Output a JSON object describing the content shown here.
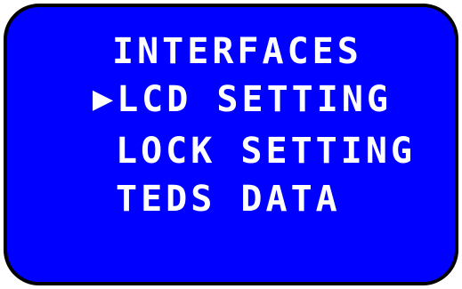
{
  "screen": {
    "background_color": "#0000ff",
    "text_color": "#ffffff",
    "border_color": "#000000"
  },
  "menu": {
    "cursor_glyph": "▶",
    "selected_index": 1,
    "items": [
      {
        "label": "INTERFACES"
      },
      {
        "label": "LCD SETTING"
      },
      {
        "label": "LOCK SETTING"
      },
      {
        "label": "TEDS DATA"
      }
    ]
  }
}
